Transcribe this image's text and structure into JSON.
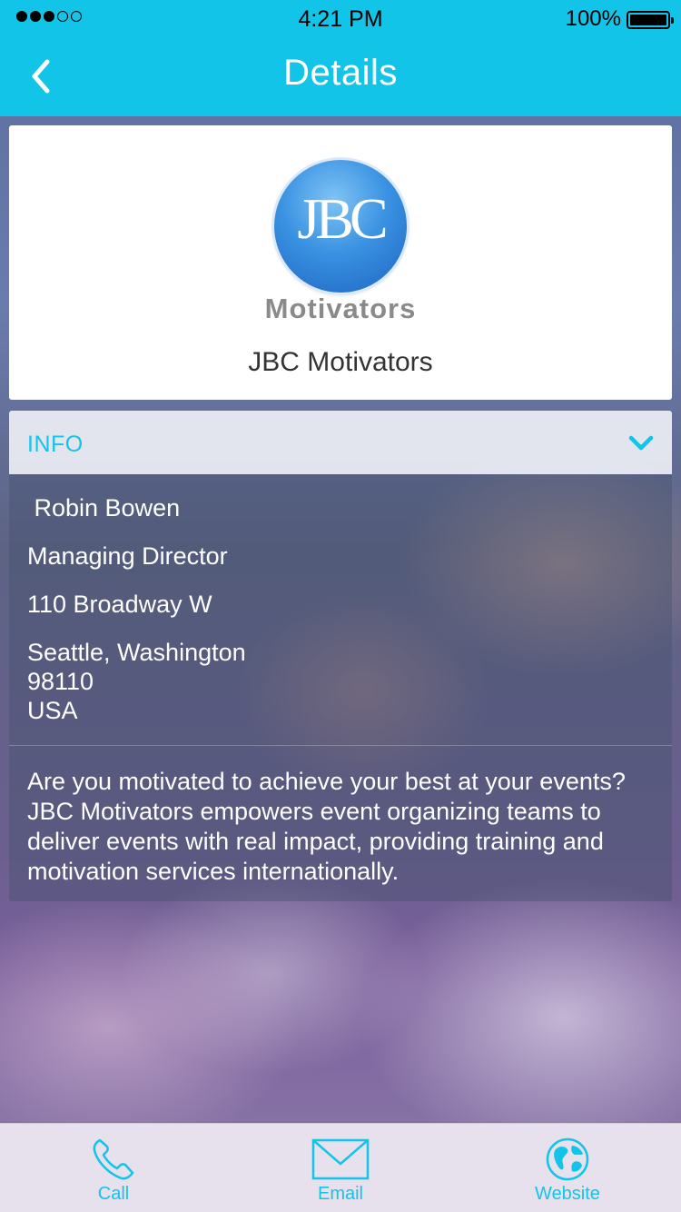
{
  "status_bar": {
    "time": "4:21 PM",
    "battery_percent": "100%",
    "signal_bars_filled": 3,
    "signal_bars_total": 5
  },
  "nav": {
    "title": "Details",
    "back_icon": "chevron-left-icon"
  },
  "header": {
    "logo_letters": "JBC",
    "logo_word": "Motivators",
    "company_name": "JBC Motivators"
  },
  "info": {
    "section_label": "INFO",
    "toggle_icon": "chevron-down-icon",
    "name": " Robin Bowen",
    "title": "Managing Director",
    "address_line": "110 Broadway W",
    "city_state": "Seattle, Washington",
    "postal_code": "98110",
    "country": "USA",
    "description": "Are you motivated to achieve your best at your events? JBC Motivators empowers event organizing teams to deliver events with real impact, providing training and motivation services internationally."
  },
  "tabs": [
    {
      "label": "Call",
      "icon": "phone-icon"
    },
    {
      "label": "Email",
      "icon": "envelope-icon"
    },
    {
      "label": "Website",
      "icon": "globe-icon"
    }
  ],
  "colors": {
    "accent": "#12c5e8",
    "card_bg": "#ffffff",
    "text_dark": "#333333"
  }
}
